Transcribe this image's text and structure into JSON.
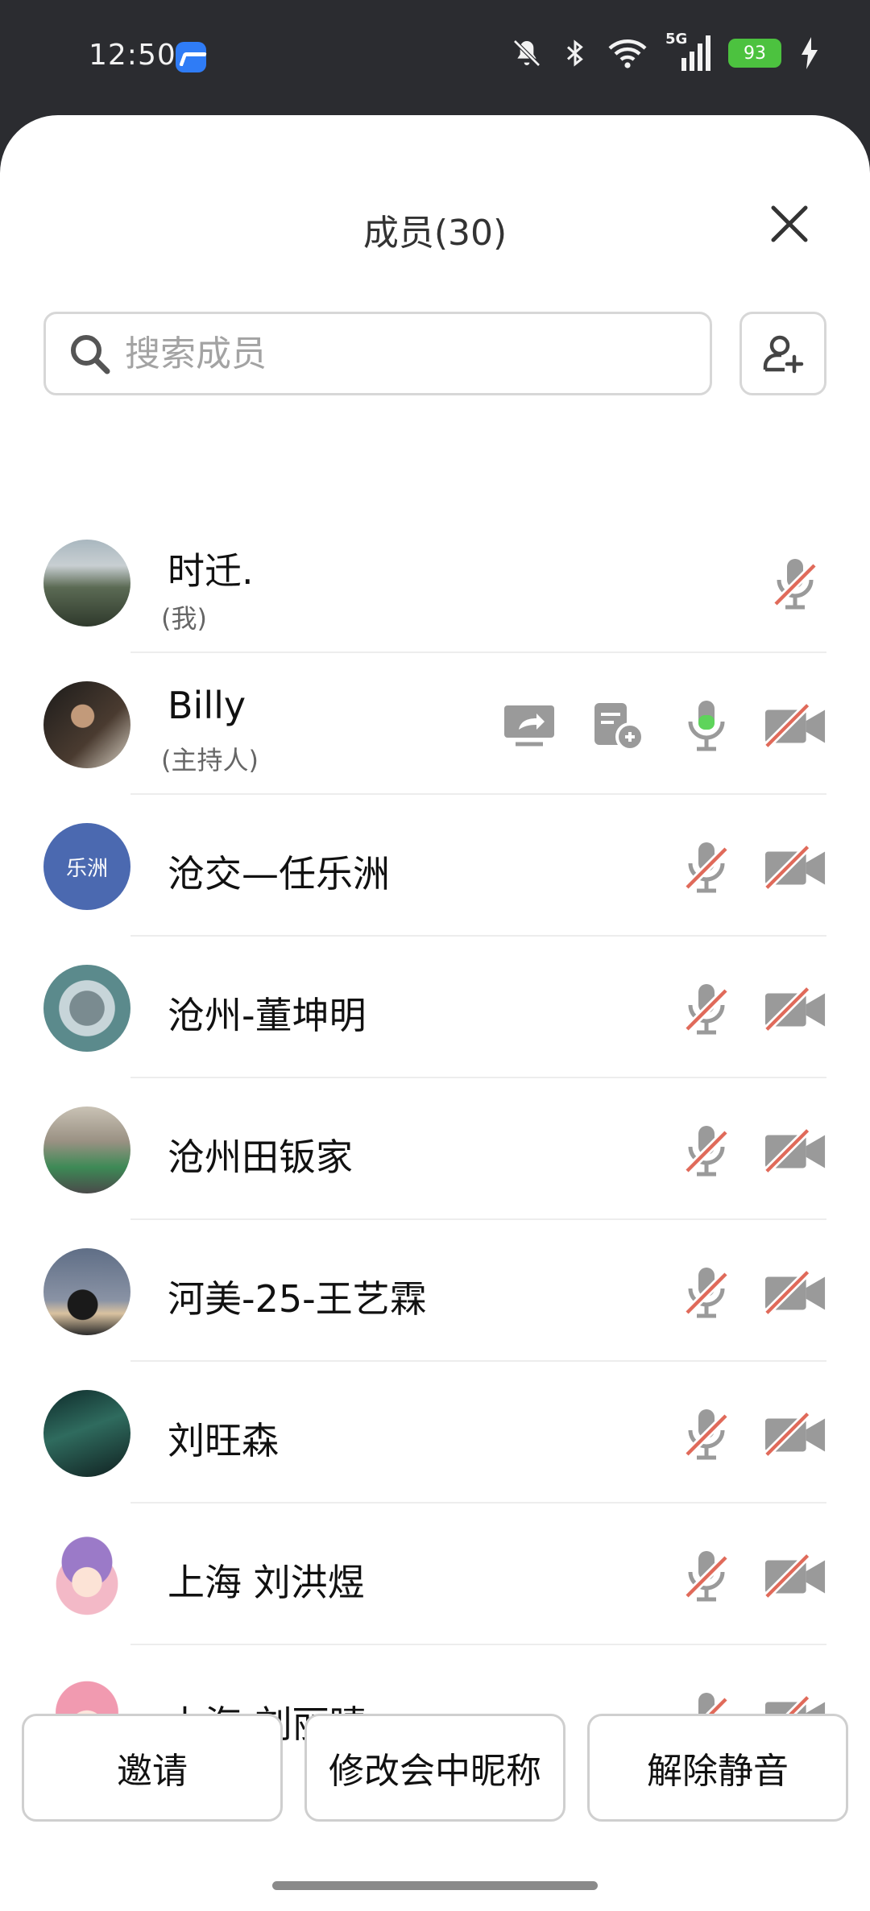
{
  "status_bar": {
    "time": "12:50",
    "battery": "93",
    "network": "5G",
    "icons": [
      "app-icon",
      "mute-icon",
      "bluetooth-icon",
      "wifi-icon",
      "signal-icon",
      "battery-icon",
      "charging-icon"
    ]
  },
  "dialog": {
    "title": "成员(30)",
    "search_placeholder": "搜索成员"
  },
  "members": [
    {
      "name": "时迁.",
      "role": "(我)",
      "avatar": "photo-mountain",
      "icons": [
        "mic-off"
      ]
    },
    {
      "name": "Billy",
      "role": "(主持人)",
      "avatar": "photo-person-reading",
      "icons": [
        "screen-share",
        "whiteboard",
        "mic-on",
        "camera-off"
      ]
    },
    {
      "name": "沧交—任乐洲",
      "avatar_text": "乐洲",
      "avatar_color": "#4b69b0",
      "icons": [
        "mic-off",
        "camera-off"
      ]
    },
    {
      "name": "沧州-董坤明",
      "avatar": "photo-chip",
      "icons": [
        "mic-off",
        "camera-off"
      ]
    },
    {
      "name": "沧州田钣家",
      "avatar": "photo-street",
      "icons": [
        "mic-off",
        "camera-off"
      ]
    },
    {
      "name": "河美-25-王艺霖",
      "avatar": "photo-sky",
      "icons": [
        "mic-off",
        "camera-off"
      ]
    },
    {
      "name": "刘旺森",
      "avatar": "photo-alley",
      "icons": [
        "mic-off",
        "camera-off"
      ]
    },
    {
      "name": "上海 刘洪煜",
      "avatar": "anime-girl-purple",
      "icons": [
        "mic-off",
        "camera-off"
      ]
    },
    {
      "name": "上海-刘丽晴",
      "avatar": "anime-girl-pink",
      "icons": [
        "mic-off",
        "camera-off"
      ]
    }
  ],
  "actions": {
    "invite": "邀请",
    "rename": "修改会中昵称",
    "unmute": "解除静音"
  },
  "colors": {
    "accent_mic_on": "#5ed45b",
    "muted_slash": "#e06a5a",
    "icon_gray": "#9a9a9a"
  }
}
